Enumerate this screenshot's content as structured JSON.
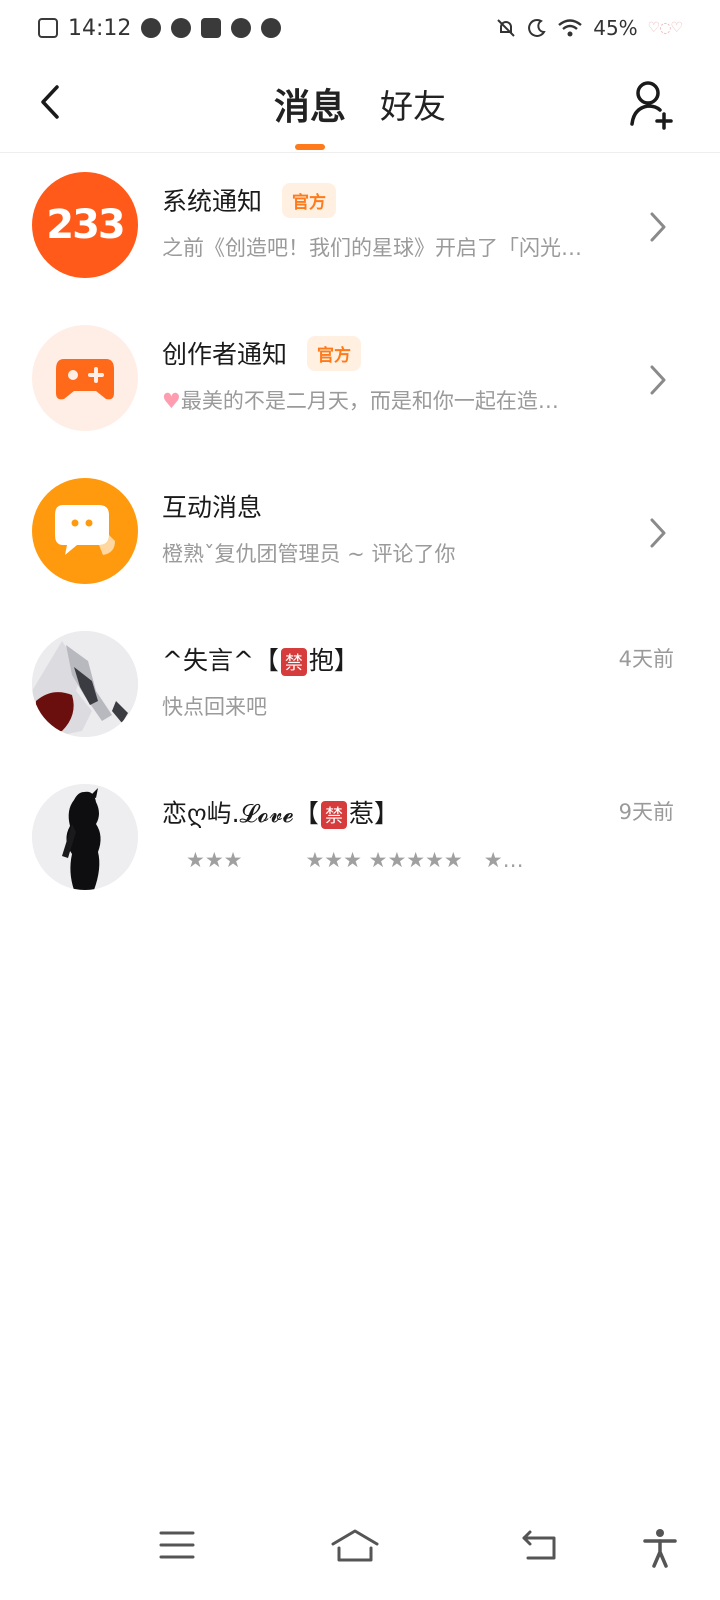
{
  "status_bar": {
    "time": "14:12",
    "battery": "45%"
  },
  "header": {
    "tabs": [
      {
        "label": "消息",
        "active": true
      },
      {
        "label": "好友",
        "active": false
      }
    ]
  },
  "conversations": [
    {
      "title": "系统通知",
      "badge": "官方",
      "preview": "之前《创造吧！我们的星球》开启了「闪光…",
      "avatar_text": "233",
      "avatar_color": "#ff5a1a"
    },
    {
      "title": "创作者通知",
      "badge": "官方",
      "preview": "最美的不是二月天，而是和你一起在造…",
      "avatar_color": "#ffeee6"
    },
    {
      "title": "互动消息",
      "preview": "橙熟ˇ复仇团管理员 ~ 评论了你",
      "avatar_color": "#ff9a0e"
    },
    {
      "title_prefix": "^失言^【",
      "title_ban": "禁",
      "title_suffix": "抱】",
      "preview": "快点回来吧",
      "time": "4天前"
    },
    {
      "title_prefix": "恋ღ屿.𝓛𝓸𝓿𝓮【",
      "title_ban": "禁",
      "title_suffix": "惹】",
      "preview": "★★★　　　★★★ ★★★★★　★…",
      "time": "9天前"
    }
  ],
  "colors": {
    "accent": "#ff7a1a",
    "muted_text": "#9a9a9a"
  }
}
